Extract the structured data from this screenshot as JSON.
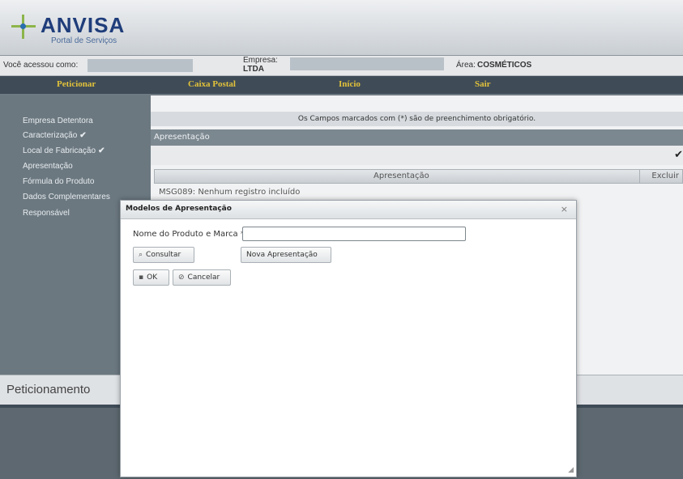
{
  "header": {
    "logo_title": "ANVISA",
    "logo_subtitle": "Portal de Serviços"
  },
  "userbar": {
    "user_label": "Você acessou como:",
    "empresa_label": "Empresa:",
    "empresa_suffix": "LTDA",
    "area_label": "Área:",
    "area_value": "COSMÉTICOS"
  },
  "nav": {
    "items": [
      "Peticionar",
      "Caixa Postal",
      "Início",
      "Sair"
    ]
  },
  "sidebar": {
    "items": [
      {
        "label": "Empresa Detentora",
        "check": ""
      },
      {
        "label": "Caracterização",
        "check": "✔"
      },
      {
        "label": "Local de Fabricação",
        "check": "✔"
      },
      {
        "label": "Apresentação",
        "check": ""
      },
      {
        "label": "Fórmula do Produto",
        "check": ""
      },
      {
        "label": "Dados Complementares",
        "check": ""
      },
      {
        "label": "Responsável",
        "check": ""
      }
    ]
  },
  "content": {
    "notice": "Os Campos marcados com (*) são de preenchimento obrigatório.",
    "section_title": "Apresentação",
    "table": {
      "col_apresentacao": "Apresentação",
      "col_excluir": "Excluir",
      "message": "MSG089: Nenhum registro incluído"
    }
  },
  "footer": {
    "title": "Peticionamento"
  },
  "modal": {
    "title": "Modelos de Apresentação",
    "close": "×",
    "field_label": "Nome do Produto e Marca *",
    "field_value": "",
    "btn_consultar": "Consultar",
    "btn_nova": "Nova Apresentação",
    "btn_ok": "OK",
    "btn_cancelar": "Cancelar"
  },
  "colors": {
    "nav_text": "#e2c23a",
    "nav_bg": "#3f4c57",
    "sidebar_bg": "#6b7880"
  }
}
